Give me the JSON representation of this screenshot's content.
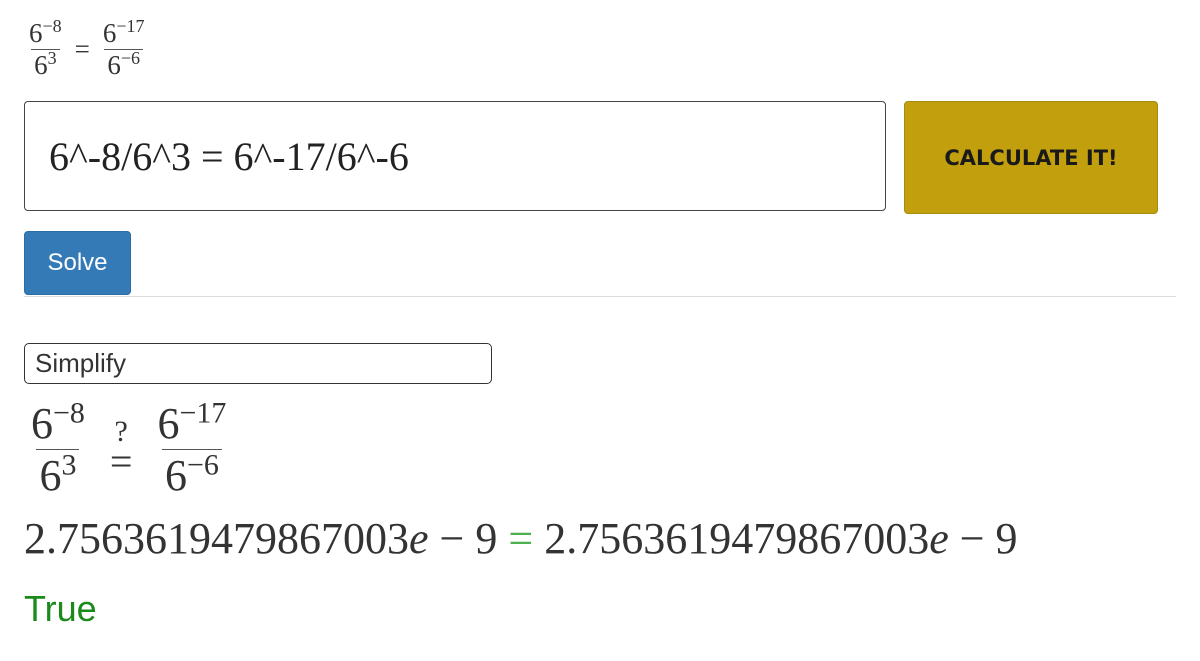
{
  "preview": {
    "lhs": {
      "num_base": "6",
      "num_exp": "−8",
      "den_base": "6",
      "den_exp": "3"
    },
    "eq": "=",
    "rhs": {
      "num_base": "6",
      "num_exp": "−17",
      "den_base": "6",
      "den_exp": "−6"
    }
  },
  "input": {
    "value": "6^-8/6^3 = 6^-17/6^-6",
    "placeholder": ""
  },
  "buttons": {
    "calculate": "CALCULATE IT!",
    "solve": "Solve"
  },
  "result": {
    "method": "Simplify",
    "lhs": {
      "num_base": "6",
      "num_exp": "−8",
      "den_base": "6",
      "den_exp": "3"
    },
    "question_mark": "?",
    "eq": "=",
    "rhs": {
      "num_base": "6",
      "num_exp": "−17",
      "den_base": "6",
      "den_exp": "−6"
    },
    "numeric": {
      "lhs_mantissa": "2.7563619479867003",
      "lhs_e": "e",
      "lhs_tail": " − 9 ",
      "eq": "=",
      "rhs_mantissa": " 2.7563619479867003",
      "rhs_e": "e",
      "rhs_tail": " − 9"
    },
    "verdict": "True"
  },
  "colors": {
    "calculate_bg": "#c29f0d",
    "solve_bg": "#337ab7",
    "verdict": "#1a8a1a",
    "equals_green": "#4caf50"
  }
}
